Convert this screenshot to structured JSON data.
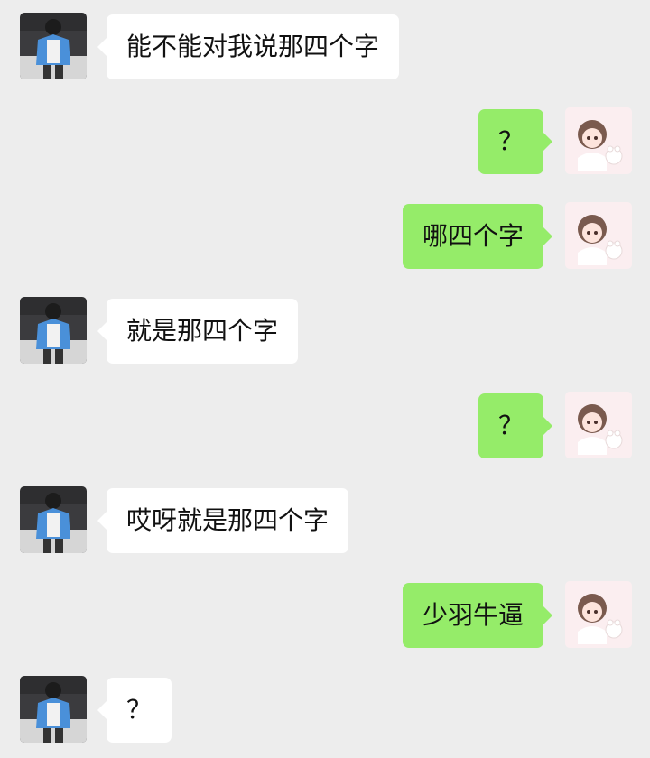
{
  "messages": [
    {
      "side": "in",
      "text": "能不能对我说那四个字"
    },
    {
      "side": "out",
      "text": "？"
    },
    {
      "side": "out",
      "text": "哪四个字"
    },
    {
      "side": "in",
      "text": "就是那四个字"
    },
    {
      "side": "out",
      "text": "？"
    },
    {
      "side": "in",
      "text": "哎呀就是那四个字"
    },
    {
      "side": "out",
      "text": "少羽牛逼"
    },
    {
      "side": "in",
      "text": "？"
    }
  ],
  "colors": {
    "background": "#ededed",
    "incoming_bubble": "#ffffff",
    "outgoing_bubble": "#95ec69"
  },
  "icons": {
    "incoming_avatar": "boy-in-blue-jacket-avatar",
    "outgoing_avatar": "anime-girl-with-cat-avatar"
  }
}
